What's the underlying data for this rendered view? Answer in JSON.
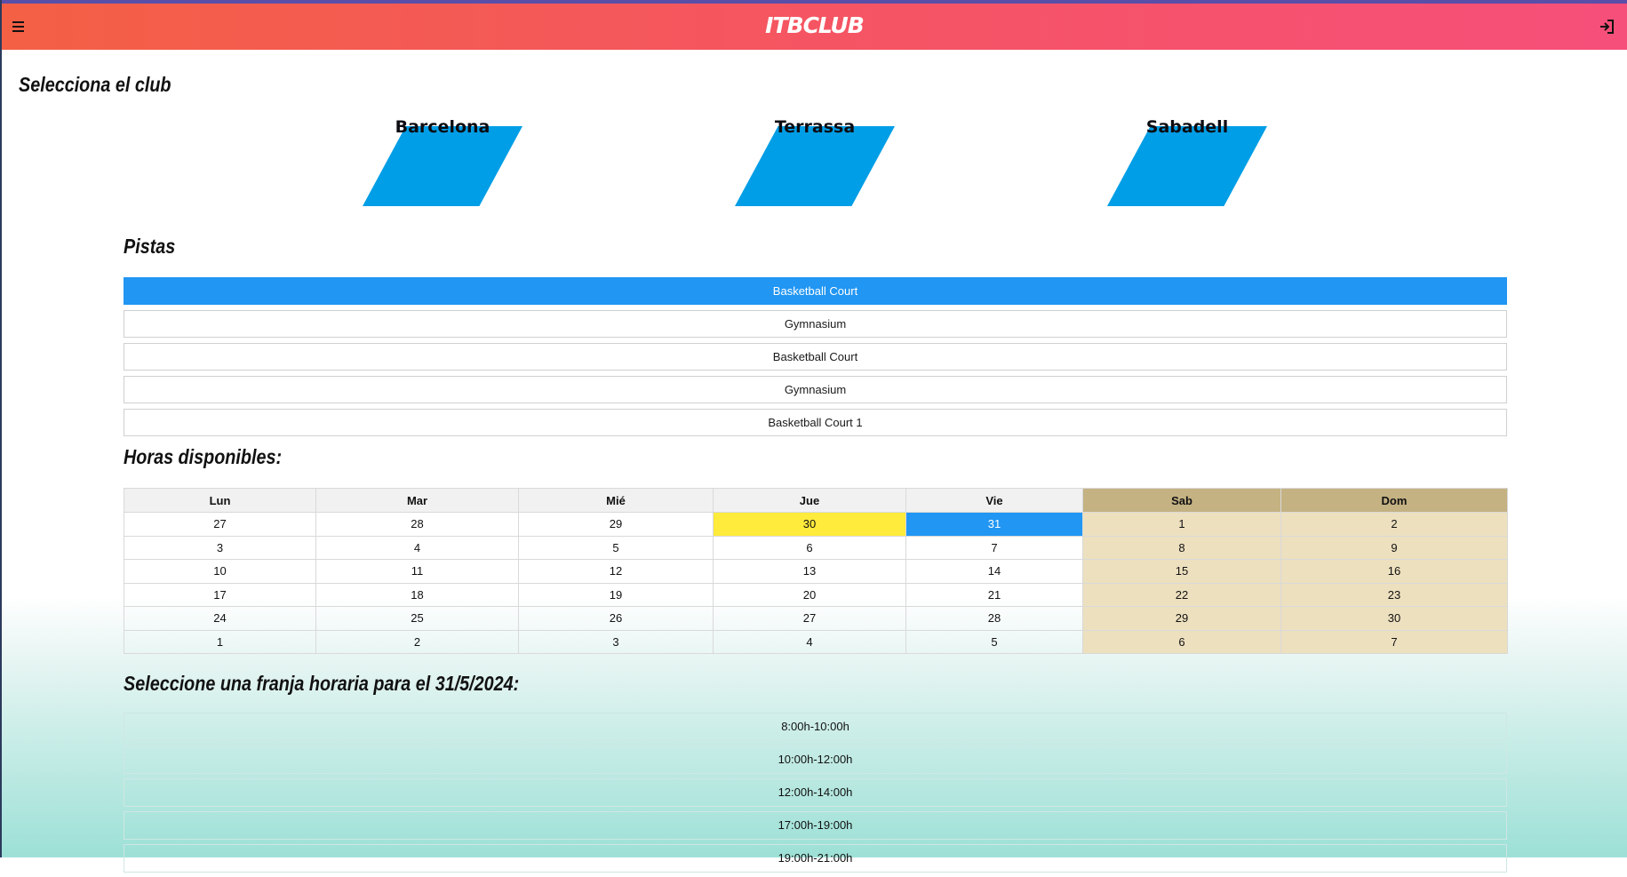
{
  "header": {
    "brand": "ITBCLUB",
    "menu_icon": "hamburger-menu-icon",
    "login_icon": "sign-in-icon",
    "gradient_colors": [
      "#f36044",
      "#f64f7a"
    ]
  },
  "clubs_section": {
    "title": "Selecciona el club",
    "clubs": [
      {
        "name": "Barcelona"
      },
      {
        "name": "Terrassa"
      },
      {
        "name": "Sabadell"
      }
    ],
    "shape_color": "#009ee6"
  },
  "courts_section": {
    "title": "Pistas",
    "selected_index": 0,
    "courts": [
      "Basketball Court",
      "Gymnasium",
      "Basketball Court",
      "Gymnasium",
      "Basketball Court 1"
    ],
    "selected_color": "#2196f3"
  },
  "calendar": {
    "title": "Horas disponibles:",
    "days": [
      "Lun",
      "Mar",
      "Mié",
      "Jue",
      "Vie",
      "Sab",
      "Dom"
    ],
    "weeks": [
      [
        "27",
        "28",
        "29",
        "30",
        "31",
        "1",
        "2"
      ],
      [
        "3",
        "4",
        "5",
        "6",
        "7",
        "8",
        "9"
      ],
      [
        "10",
        "11",
        "12",
        "13",
        "14",
        "15",
        "16"
      ],
      [
        "17",
        "18",
        "19",
        "20",
        "21",
        "22",
        "23"
      ],
      [
        "24",
        "25",
        "26",
        "27",
        "28",
        "29",
        "30"
      ],
      [
        "1",
        "2",
        "3",
        "4",
        "5",
        "6",
        "7"
      ]
    ],
    "today": "30",
    "selected": "31",
    "today_color": "#ffeb3b",
    "selected_color": "#2196f3",
    "weekend_header_color": "#c4b283",
    "weekend_cell_color": "#ede0bf"
  },
  "slots_section": {
    "title": "Seleccione una franja horaria para el 31/5/2024:",
    "slots": [
      "8:00h-10:00h",
      "10:00h-12:00h",
      "12:00h-14:00h",
      "17:00h-19:00h",
      "19:00h-21:00h"
    ]
  }
}
